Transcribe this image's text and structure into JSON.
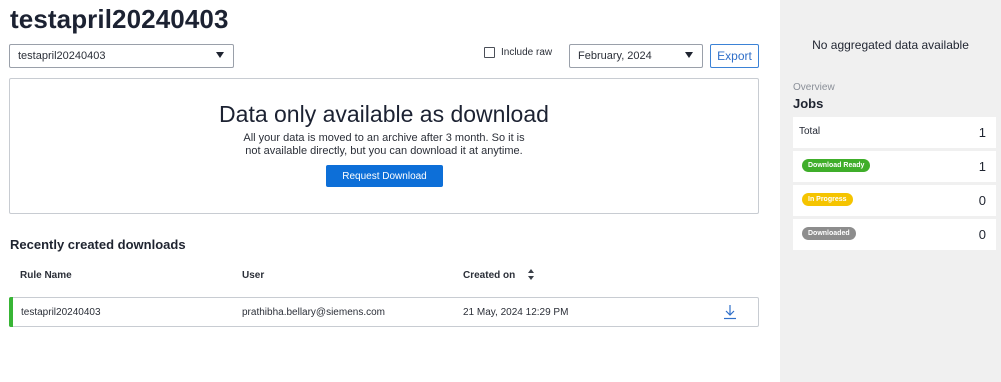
{
  "page": {
    "title": "testapril20240403"
  },
  "toolbar": {
    "asset_select_value": "testapril20240403",
    "include_raw_label": "Include raw",
    "include_raw_checked": false,
    "month_select_value": "February, 2024",
    "export_label": "Export"
  },
  "download_card": {
    "heading": "Data only available as download",
    "desc_line1": "All your data is moved to an archive after 3 month. So it is",
    "desc_line2": "not available directly, but you can download it at anytime.",
    "request_label": "Request Download"
  },
  "downloads": {
    "title": "Recently created downloads",
    "columns": [
      "Rule Name",
      "User",
      "Created on"
    ],
    "rows": [
      {
        "rule_name": "testapril20240403",
        "user": "prathibha.bellary@siemens.com",
        "created_on": "21 May, 2024 12:29 PM",
        "status_color": "#38b535",
        "icon": "download-icon"
      }
    ]
  },
  "sidebar": {
    "no_data": "No aggregated data available",
    "overview_label": "Overview",
    "jobs_title": "Jobs",
    "jobs": [
      {
        "label": "Total",
        "count": "1"
      },
      {
        "label": "Download Ready",
        "count": "1",
        "color": "#3fae2a"
      },
      {
        "label": "In Progress",
        "count": "0",
        "color": "#f5c400"
      },
      {
        "label": "Downloaded",
        "count": "0",
        "color": "#8d8d8d"
      }
    ]
  },
  "colors": {
    "primary": "#0d6fd8",
    "accent_green": "#38b535"
  }
}
